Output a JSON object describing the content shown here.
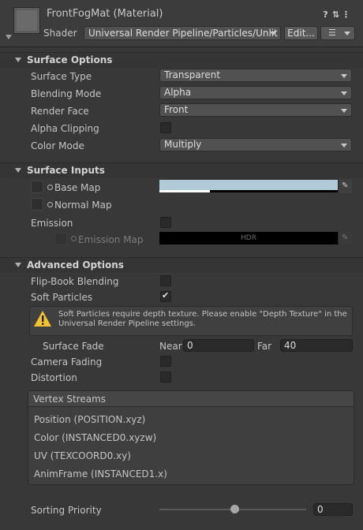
{
  "header": {
    "material_title": "FrontFogMat (Material)",
    "shader_label": "Shader",
    "shader_value": "Universal Render Pipeline/Particles/Unlit",
    "edit_label": "Edit...",
    "list_icon": "list-icon",
    "icons": [
      "help-icon",
      "preset-icon",
      "kebab-menu-icon"
    ]
  },
  "surface_options": {
    "title": "Surface Options",
    "surface_type": {
      "label": "Surface Type",
      "value": "Transparent"
    },
    "blending_mode": {
      "label": "Blending Mode",
      "value": "Alpha"
    },
    "render_face": {
      "label": "Render Face",
      "value": "Front"
    },
    "alpha_clipping": {
      "label": "Alpha Clipping",
      "checked": false
    },
    "color_mode": {
      "label": "Color Mode",
      "value": "Multiply"
    }
  },
  "surface_inputs": {
    "title": "Surface Inputs",
    "base_map": {
      "label": "Base Map",
      "color": "#b1cad8"
    },
    "normal_map": {
      "label": "Normal Map"
    },
    "emission": {
      "label": "Emission",
      "checked": false
    },
    "emission_map": {
      "label": "Emission Map",
      "hdr_label": "HDR",
      "color": "#000000"
    }
  },
  "advanced_options": {
    "title": "Advanced Options",
    "flipbook_blending": {
      "label": "Flip-Book Blending",
      "checked": false
    },
    "soft_particles": {
      "label": "Soft Particles",
      "checked": true
    },
    "warning": "Soft Particles require depth texture. Please enable \"Depth Texture\" in the Universal Render Pipeline settings.",
    "surface_fade": {
      "label": "Surface Fade",
      "near_label": "Near",
      "near_value": "0",
      "far_label": "Far",
      "far_value": "40"
    },
    "camera_fading": {
      "label": "Camera Fading",
      "checked": false
    },
    "distortion": {
      "label": "Distortion",
      "checked": false
    },
    "vertex_streams": {
      "title": "Vertex Streams",
      "items": [
        "Position (POSITION.xyz)",
        "Color (INSTANCED0.xyzw)",
        "UV (TEXCOORD0.xy)",
        "AnimFrame (INSTANCED1.x)"
      ]
    },
    "sorting_priority": {
      "label": "Sorting Priority",
      "value": "0",
      "slider_fraction": 0.5
    }
  },
  "colors": {
    "background": "#383838",
    "header": "#3c3c3c",
    "warning_icon": "#f2c230"
  }
}
